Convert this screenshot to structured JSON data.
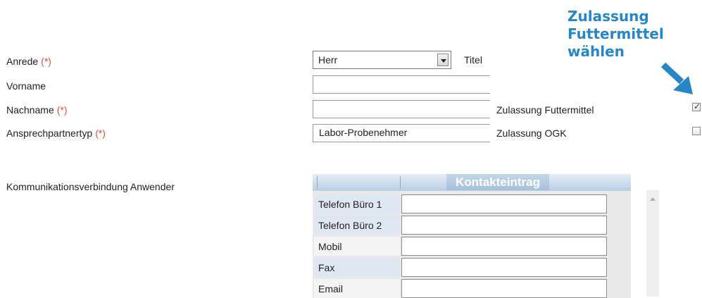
{
  "hint": {
    "line1": "Zulassung",
    "line2": "Futtermittel",
    "line3": "wählen",
    "arrow_icon": "arrow-down-right-icon",
    "color": "#2786c8"
  },
  "form": {
    "required_marker": "(*)",
    "anrede": {
      "label": "Anrede",
      "value": "Herr"
    },
    "titel": {
      "label": "Titel"
    },
    "vorname": {
      "label": "Vorname",
      "value": ""
    },
    "nachname": {
      "label": "Nachname",
      "value": ""
    },
    "ansprechpartnertyp": {
      "label": "Ansprechpartnertyp",
      "value": "Labor-Probenehmer"
    },
    "zulassung_futtermittel": {
      "label": "Zulassung Futtermittel",
      "checked": true
    },
    "zulassung_ogk": {
      "label": "Zulassung OGK",
      "checked": false
    },
    "kommunikation_label": "Kommunikationsverbindung Anwender"
  },
  "contact_table": {
    "title": "Kontakteintrag",
    "rows": [
      {
        "label": "Telefon Büro 1",
        "value": ""
      },
      {
        "label": "Telefon Büro 2",
        "value": ""
      },
      {
        "label": "Mobil",
        "value": ""
      },
      {
        "label": "Fax",
        "value": ""
      },
      {
        "label": "Email",
        "value": ""
      }
    ]
  }
}
